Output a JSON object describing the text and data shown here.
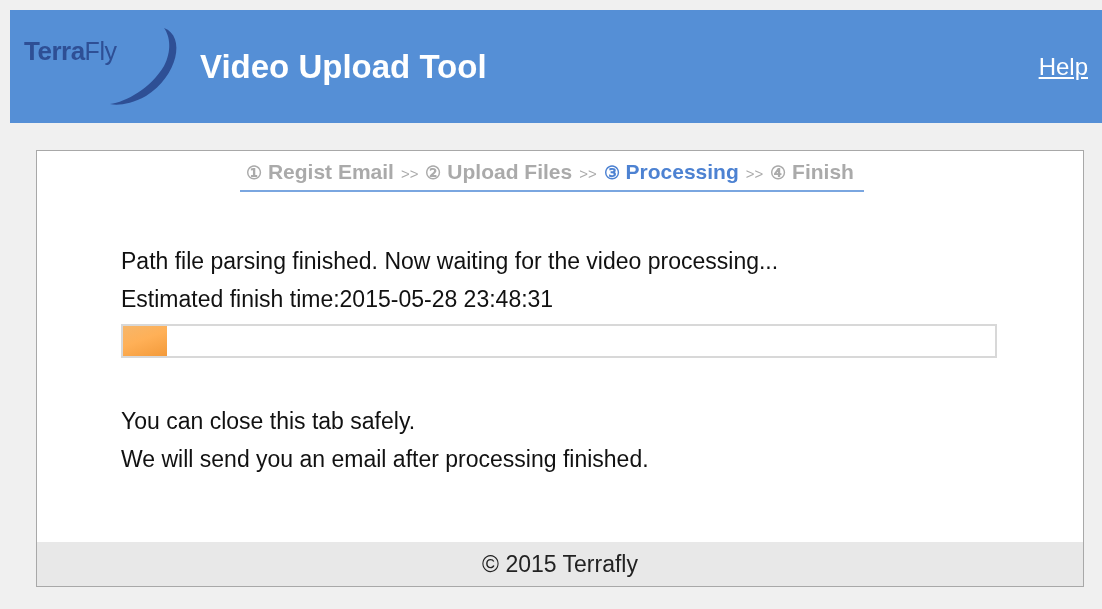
{
  "header": {
    "logo": {
      "strong": "Terra",
      "light": "Fly"
    },
    "title": "Video Upload Tool",
    "help_link": "Help"
  },
  "steps": [
    {
      "number": "①",
      "label": "Regist Email",
      "selected": false,
      "separator": ">>"
    },
    {
      "number": "②",
      "label": "Upload Files",
      "selected": false,
      "separator": ">>"
    },
    {
      "number": "③",
      "label": "Processing",
      "selected": true,
      "separator": ">>"
    },
    {
      "number": "④",
      "label": "Finish",
      "selected": false
    }
  ],
  "status": {
    "message": "Path file parsing finished. Now waiting for the video processing...",
    "estimate": "Estimated finish time:2015-05-28 23:48:31"
  },
  "progress": {
    "level": 0.05
  },
  "notes": [
    "You can close this tab safely.",
    "We will send you an email after processing finished."
  ],
  "footer": "© 2015 Terrafly"
}
